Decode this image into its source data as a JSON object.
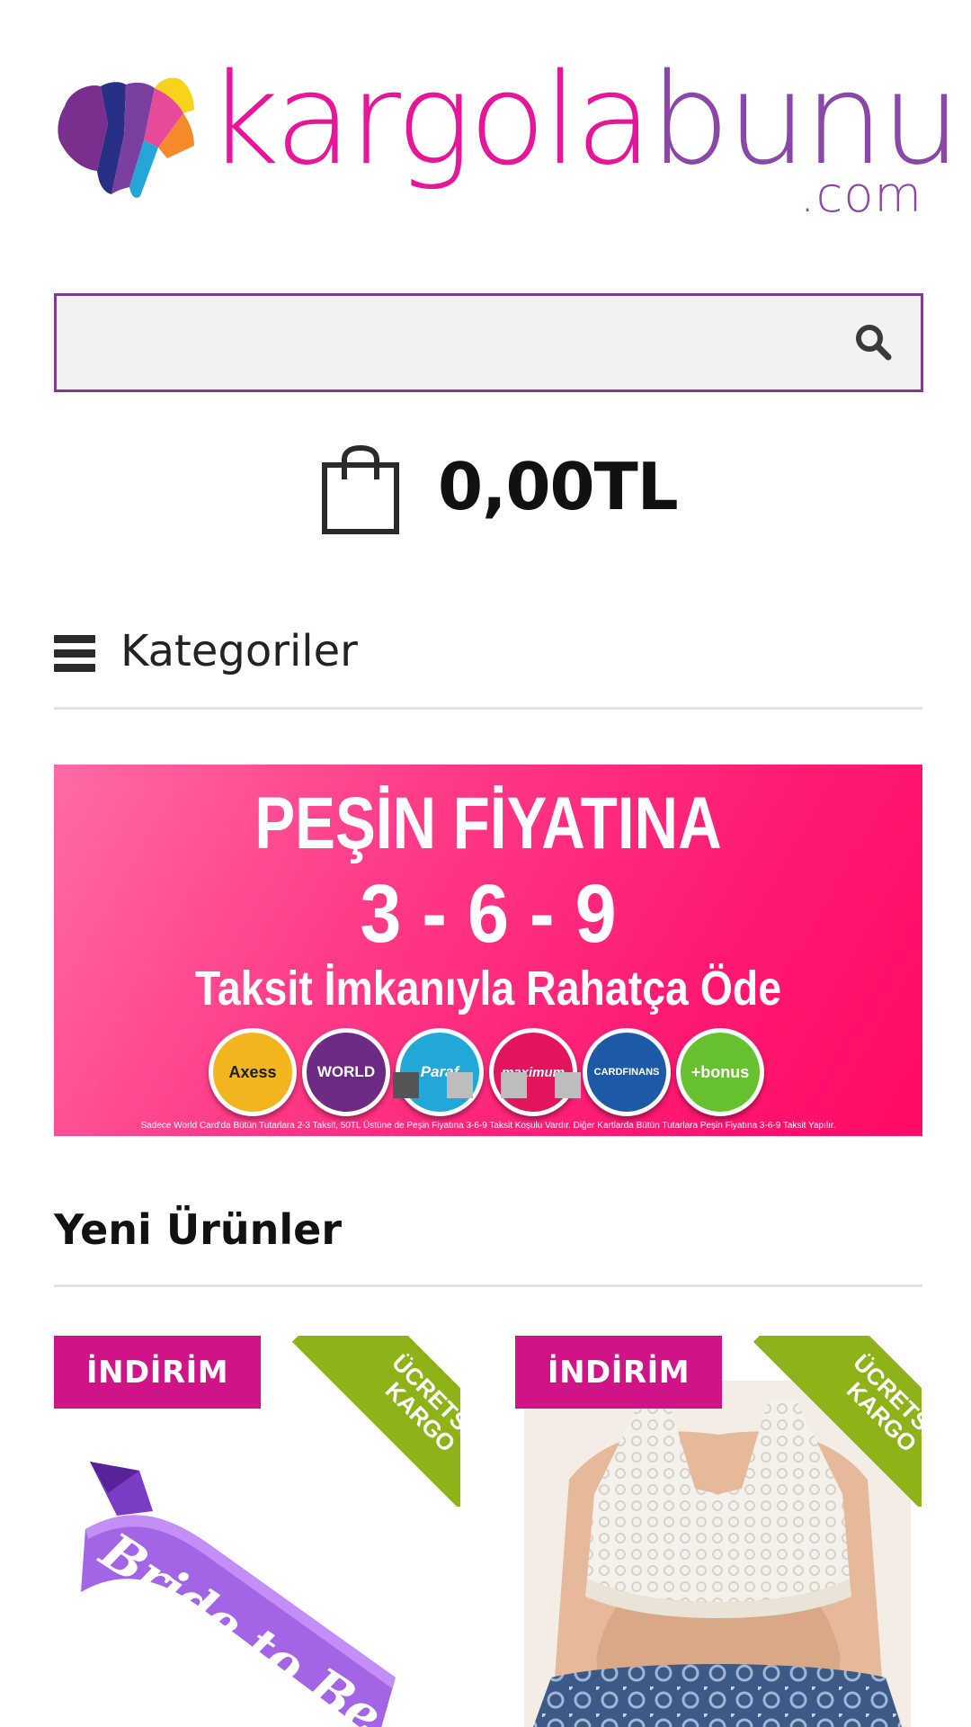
{
  "brand": {
    "name_part1": "kargola",
    "name_part2": "bunu",
    "domain_suffix": ".com",
    "colors": {
      "pink": "#e6159a",
      "purple": "#8b47a8"
    }
  },
  "search": {
    "value": "",
    "placeholder": "",
    "button_icon": "search-icon",
    "border_color": "#7e3d8f"
  },
  "cart": {
    "icon": "shopping-bag-icon",
    "total": "0,00TL"
  },
  "categories": {
    "icon": "hamburger-menu-icon",
    "label": "Kategoriler"
  },
  "banner": {
    "line1": "PEŞİN FİYATINA",
    "line2": "3 - 6 - 9",
    "line3": "Taksit İmkanıyla Rahatça Öde",
    "cards": [
      "Axess",
      "WORLD",
      "Paraf",
      "maximum",
      "CARDFINANS",
      "+bonus"
    ],
    "note": "Sadece World Card'da Bütün Tutarlara 2-3 Taksit, 50TL Üstüne de Peşin Fiyatına 3-6-9 Taksit Koşulu Vardır. Diğer Kartlarda Bütün Tutarlara Peşin Fiyatına 3-6-9 Taksit Yapılır.",
    "slides_count": 4,
    "active_slide": 1,
    "colors": {
      "gradient_start": "#ff6aa6",
      "gradient_end": "#ff0a66"
    }
  },
  "new_products": {
    "title": "Yeni Ürünler",
    "items": [
      {
        "badge": "İNDİRİM",
        "ribbon_line1": "ÜCRETSİZ",
        "ribbon_line2": "KARGO",
        "image_text": "Bride to Be"
      },
      {
        "badge": "İNDİRİM",
        "ribbon_line1": "ÜCRETSİZ",
        "ribbon_line2": "KARGO"
      }
    ],
    "colors": {
      "badge": "#d01488",
      "ribbon": "#8db318"
    }
  }
}
